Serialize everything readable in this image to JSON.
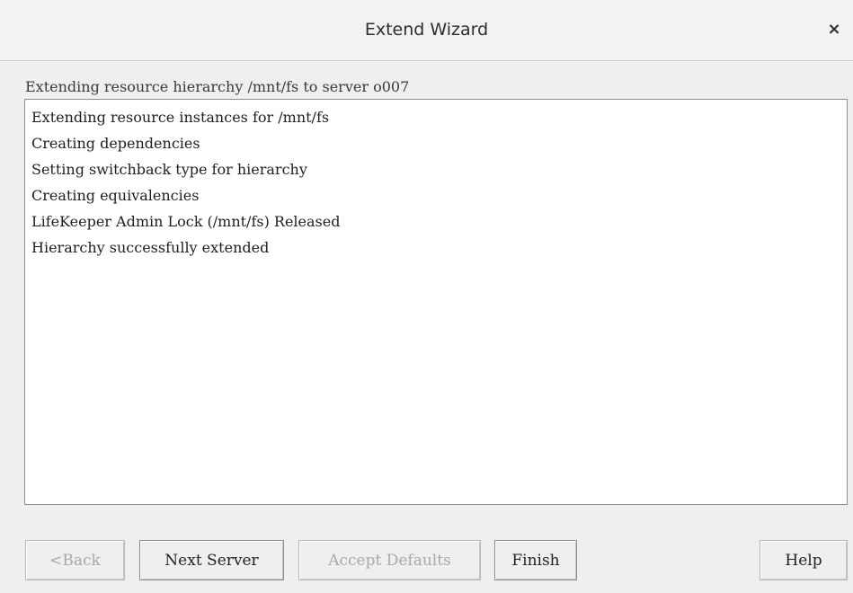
{
  "window": {
    "title": "Extend Wizard",
    "close_glyph": "×"
  },
  "heading": "Extending resource hierarchy /mnt/fs to server o007",
  "log_lines": [
    "Extending resource instances for /mnt/fs",
    "Creating dependencies",
    "Setting switchback type for hierarchy",
    "Creating equivalencies",
    "LifeKeeper Admin Lock (/mnt/fs) Released",
    "Hierarchy successfully extended"
  ],
  "buttons": {
    "back": {
      "label": "<Back",
      "enabled": false
    },
    "next_server": {
      "label": "Next Server",
      "enabled": true
    },
    "accept_defaults": {
      "label": "Accept Defaults",
      "enabled": false
    },
    "finish": {
      "label": "Finish",
      "enabled": true
    },
    "help": {
      "label": "Help",
      "enabled": true
    }
  }
}
